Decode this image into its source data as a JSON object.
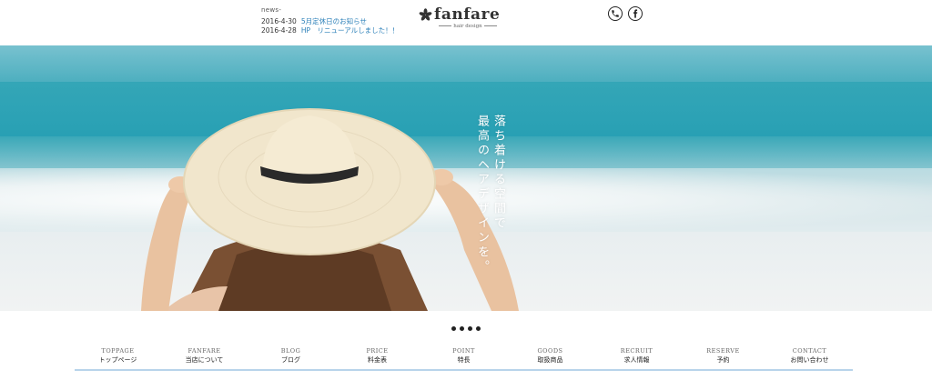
{
  "news": {
    "label": "news-",
    "items": [
      {
        "date": "2016-4-30",
        "title": "5月定休日のお知らせ"
      },
      {
        "date": "2016-4-28",
        "title": "HP　リニューアルしました！！"
      }
    ]
  },
  "logo": {
    "name": "fanfare",
    "sub": "hair design"
  },
  "header_icons": [
    "phone-icon",
    "facebook-icon"
  ],
  "hero": {
    "catch_line1": "落ち着ける空間で",
    "catch_line2": "最高のヘアデザインを。"
  },
  "slider": {
    "dot_count": 4
  },
  "nav": [
    {
      "en": "TOPPAGE",
      "ja": "トップページ"
    },
    {
      "en": "FANFARE",
      "ja": "当店について"
    },
    {
      "en": "BLOG",
      "ja": "ブログ"
    },
    {
      "en": "PRICE",
      "ja": "料金表"
    },
    {
      "en": "POINT",
      "ja": "特長"
    },
    {
      "en": "GOODS",
      "ja": "取扱商品"
    },
    {
      "en": "RECRUIT",
      "ja": "求人情報"
    },
    {
      "en": "RESERVE",
      "ja": "予約"
    },
    {
      "en": "CONTACT",
      "ja": "お問い合わせ"
    }
  ],
  "colors": {
    "link": "#2a7fb8",
    "nav_underline": "#b8d4ea",
    "sea": "#2e9fb3"
  }
}
